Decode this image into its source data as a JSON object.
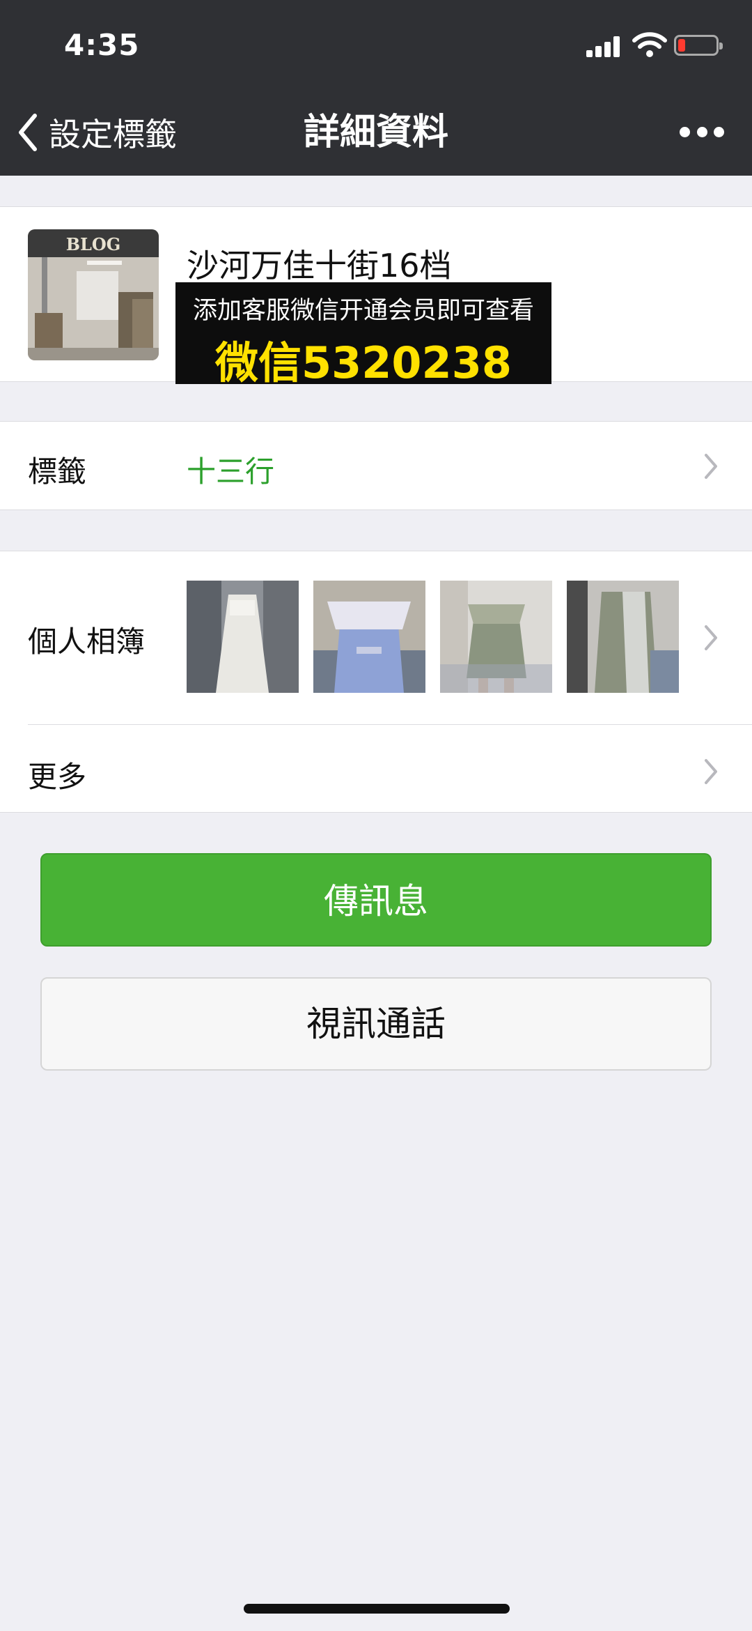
{
  "status_bar": {
    "time": "4:35"
  },
  "nav": {
    "back_label": "設定標籤",
    "title": "詳細資料"
  },
  "profile": {
    "name": "沙河万佳十街16档",
    "avatar_sign_text": "BLOG",
    "promo_line1": "添加客服微信开通会员即可查看",
    "promo_line2": "微信5320238"
  },
  "tags_row": {
    "label": "標籤",
    "value": "十三行",
    "value_color": "#2ca02c"
  },
  "album_row": {
    "label": "個人相簿",
    "photo_count": 4
  },
  "more_row": {
    "label": "更多"
  },
  "buttons": {
    "message": "傳訊息",
    "video_call": "視訊通話"
  },
  "colors": {
    "nav_bg": "#2f3034",
    "page_bg": "#efeff4",
    "primary_green": "#48b235",
    "promo_yellow": "#ffe100"
  }
}
